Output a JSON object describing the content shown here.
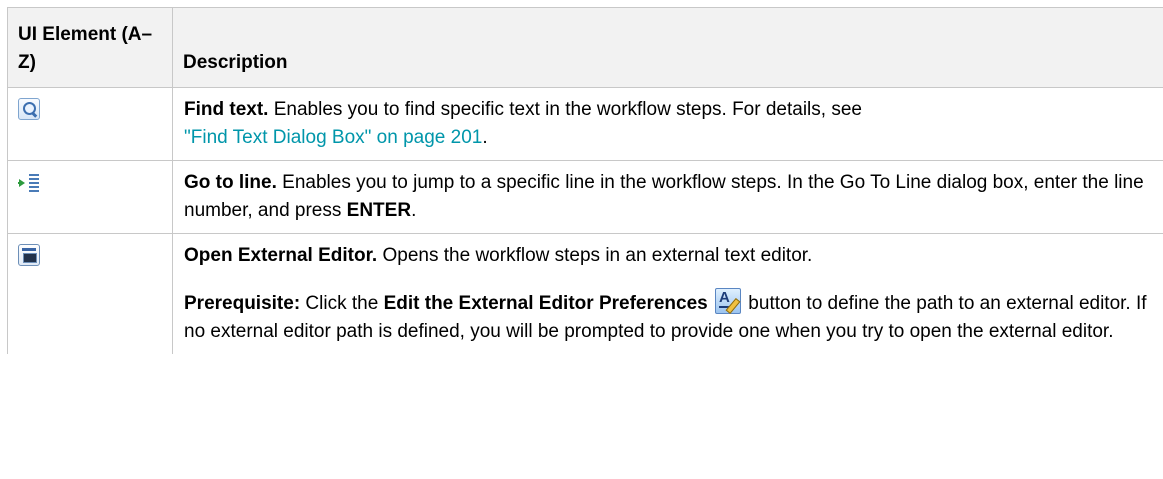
{
  "table": {
    "headers": {
      "ui_element": "UI Element (A–Z)",
      "description": "Description"
    },
    "rows": [
      {
        "icon": "search-icon",
        "title": "Find text.",
        "text": " Enables you to find specific text in the workflow steps. For details, see ",
        "link": "\"Find Text Dialog Box\" on page 201",
        "after_link": "."
      },
      {
        "icon": "go-to-line-icon",
        "title": "Go to line.",
        "text": " Enables you to jump to a specific line in the workflow steps. In the Go To Line dialog box, enter the line number, and press ",
        "key": "ENTER",
        "after_key": "."
      },
      {
        "icon": "external-editor-icon",
        "title": "Open External Editor.",
        "text": " Opens the workflow steps in an external text editor.",
        "prereq_label": "Prerequisite:",
        "prereq_text_1": " Click the ",
        "prereq_button": "Edit the External Editor Preferences",
        "prereq_icon": "editor-preferences-icon",
        "prereq_text_2": " button to define the path to an external editor. If no external editor path is defined, you will be prompted to provide one when you try to open the external editor."
      }
    ]
  },
  "colors": {
    "header_bg": "#f2f2f2",
    "border": "#c8c8c8",
    "link": "#0096aa"
  }
}
